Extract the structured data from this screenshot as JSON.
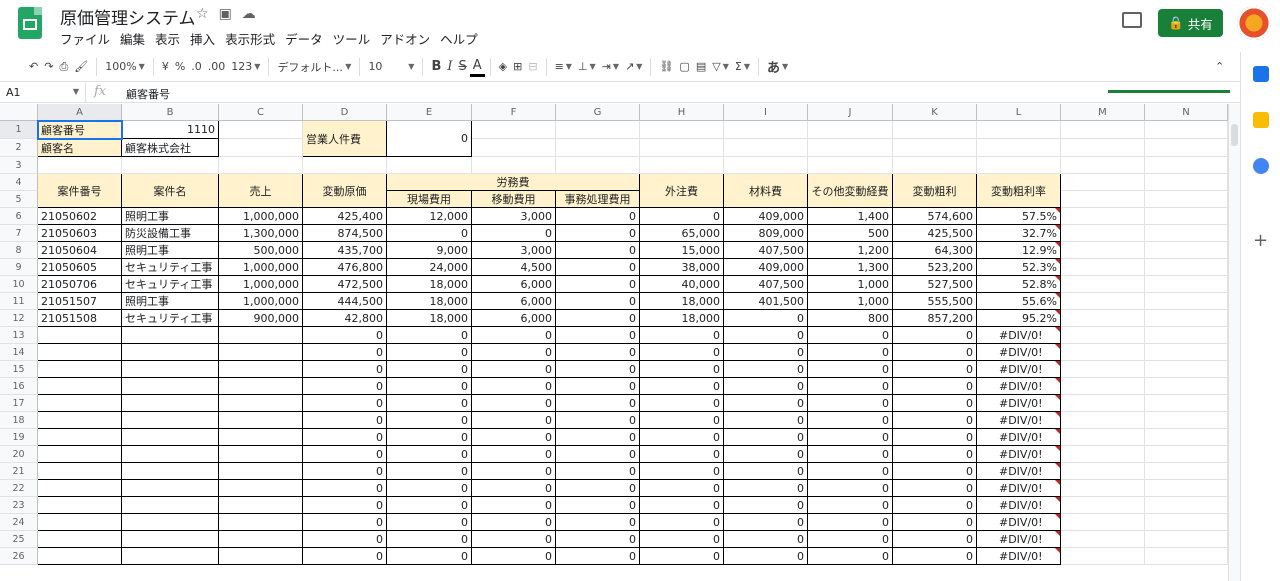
{
  "app": {
    "title": "原価管理システム",
    "share_label": "共有"
  },
  "menu": [
    "ファイル",
    "編集",
    "表示",
    "挿入",
    "表示形式",
    "データ",
    "ツール",
    "アドオン",
    "ヘルプ"
  ],
  "toolbar": {
    "zoom": "100%",
    "currency": "¥",
    "percent": "%",
    "dec_dec": ".0",
    "dec_inc": ".00",
    "format_more": "123",
    "font": "デフォルト...",
    "font_size": "10",
    "bold": "B",
    "italic": "I",
    "strike": "S",
    "textcolor": "A",
    "input_tool": "あ"
  },
  "formula_bar": {
    "cell_ref": "A1",
    "fx": "fx",
    "value": "顧客番号"
  },
  "columns": [
    "A",
    "B",
    "C",
    "D",
    "E",
    "F",
    "G",
    "H",
    "I",
    "J",
    "K",
    "L",
    "M",
    "N"
  ],
  "rows": [
    "1",
    "2",
    "3",
    "4",
    "5",
    "6",
    "7",
    "8",
    "9",
    "10",
    "11",
    "12",
    "13",
    "14",
    "15",
    "16",
    "17",
    "18",
    "19",
    "20",
    "21",
    "22",
    "23",
    "24",
    "25",
    "26"
  ],
  "cells": {
    "a1": "顧客番号",
    "b1": "1110",
    "a2": "顧客名",
    "b2": "顧客株式会社",
    "d1": "営業人件費",
    "e1": "0",
    "h_a": "案件番号",
    "h_b": "案件名",
    "h_c": "売上",
    "h_d": "変動原価",
    "h_e": "労務費",
    "h_e5": "現場費用",
    "h_f5": "移動費用",
    "h_g5": "事務処理費用",
    "h_h": "外注費",
    "h_i": "材料費",
    "h_j": "その他変動経費",
    "h_k": "変動粗利",
    "h_l": "変動粗利率"
  },
  "data_rows": [
    [
      "21050602",
      "照明工事",
      "1,000,000",
      "425,400",
      "12,000",
      "3,000",
      "0",
      "0",
      "409,000",
      "1,400",
      "574,600",
      "57.5%"
    ],
    [
      "21050603",
      "防災設備工事",
      "1,300,000",
      "874,500",
      "0",
      "0",
      "0",
      "65,000",
      "809,000",
      "500",
      "425,500",
      "32.7%"
    ],
    [
      "21050604",
      "照明工事",
      "500,000",
      "435,700",
      "9,000",
      "3,000",
      "0",
      "15,000",
      "407,500",
      "1,200",
      "64,300",
      "12.9%"
    ],
    [
      "21050605",
      "セキュリティ工事",
      "1,000,000",
      "476,800",
      "24,000",
      "4,500",
      "0",
      "38,000",
      "409,000",
      "1,300",
      "523,200",
      "52.3%"
    ],
    [
      "21050706",
      "セキュリティ工事",
      "1,000,000",
      "472,500",
      "18,000",
      "6,000",
      "0",
      "40,000",
      "407,500",
      "1,000",
      "527,500",
      "52.8%"
    ],
    [
      "21051507",
      "照明工事",
      "1,000,000",
      "444,500",
      "18,000",
      "6,000",
      "0",
      "18,000",
      "401,500",
      "1,000",
      "555,500",
      "55.6%"
    ],
    [
      "21051508",
      "セキュリティ工事",
      "900,000",
      "42,800",
      "18,000",
      "6,000",
      "0",
      "18,000",
      "0",
      "800",
      "857,200",
      "95.2%"
    ]
  ],
  "empty_row": [
    "",
    "",
    "",
    "0",
    "0",
    "0",
    "0",
    "0",
    "0",
    "0",
    "0",
    "#DIV/0!"
  ],
  "colors": {
    "accent": "#1a73e8",
    "header_fill": "#fff2cc",
    "share": "#188038",
    "error_flag": "#c5221f"
  }
}
